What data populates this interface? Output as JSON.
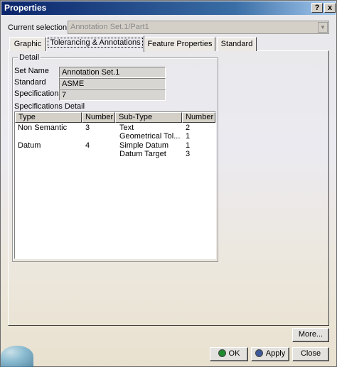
{
  "window": {
    "title": "Properties",
    "help_glyph": "?",
    "close_glyph": "x"
  },
  "selection": {
    "label": "Current selection :",
    "value": "Annotation Set.1/Part1",
    "arrow": "▼"
  },
  "tabs": [
    {
      "label": "Graphic",
      "active": false
    },
    {
      "label": "Tolerancing & Annotations",
      "active": true
    },
    {
      "label": "Feature Properties",
      "active": false
    },
    {
      "label": "Standard",
      "active": false
    }
  ],
  "detail": {
    "group_title": "Detail",
    "set_name_label": "Set Name",
    "set_name_value": "Annotation Set.1",
    "standard_label": "Standard",
    "standard_value": "ASME",
    "specifications_label": "Specifications",
    "specifications_value": "7",
    "specs_detail_label": "Specifications Detail"
  },
  "spec_table": {
    "columns": [
      "Type",
      "Number",
      "Sub-Type",
      "Number"
    ],
    "rows": [
      [
        "Non Semantic",
        "3",
        "Text",
        "2"
      ],
      [
        "",
        "",
        "Geometrical Tol...",
        "1"
      ],
      [
        "Datum",
        "4",
        "Simple Datum",
        "1"
      ],
      [
        "",
        "",
        "Datum Target",
        "3"
      ]
    ]
  },
  "buttons": {
    "more": "More...",
    "ok": "OK",
    "apply": "Apply",
    "close": "Close"
  },
  "colors": {
    "title_bar": "#0a246a",
    "ok_icon": "#1f8a2e",
    "apply_icon": "#3c5a9a"
  }
}
